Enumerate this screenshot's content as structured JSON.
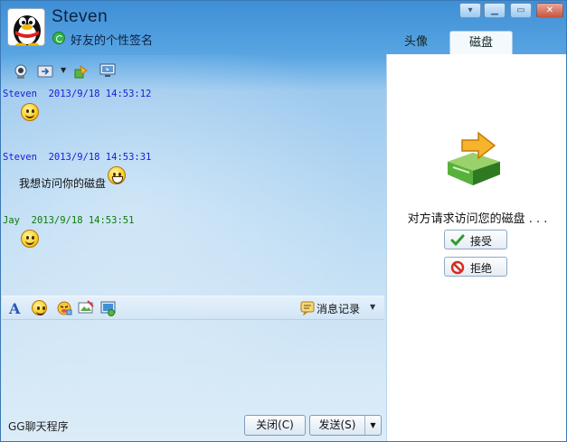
{
  "window": {
    "nickname": "Steven",
    "signature": "好友的个性签名",
    "controls": [
      "menu-icon",
      "minimize-icon",
      "maximize-icon",
      "close-icon"
    ]
  },
  "tabs": [
    {
      "label": "头像",
      "active": false
    },
    {
      "label": "磁盘",
      "active": true
    }
  ],
  "toolbar_top": {
    "icons": [
      "webcam-icon",
      "file-transfer-icon",
      "dropdown-arrow-icon",
      "apps-icon",
      "remote-desktop-icon"
    ]
  },
  "messages": [
    {
      "sender": "Steven",
      "time": "2013/9/18 14:53:12",
      "text": "",
      "emoticon": "smile-emoticon",
      "color": "#1a1ad6"
    },
    {
      "sender": "Steven",
      "time": "2013/9/18 14:53:31",
      "text": "我想访问你的磁盘",
      "emoticon": "grin-emoticon",
      "color": "#1a1ad6"
    },
    {
      "sender": "Jay",
      "time": "2013/9/18 14:53:51",
      "text": "",
      "emoticon": "smile-emoticon",
      "color": "#0b7a0b"
    }
  ],
  "input_toolbar": {
    "icons": [
      "font-icon",
      "emoticon-icon",
      "magic-emoticon-icon",
      "screenshot-icon",
      "image-icon"
    ],
    "font_glyph": "A",
    "history_label": "消息记录"
  },
  "right_panel": {
    "request_text": "对方请求访问您的磁盘 . . .",
    "accept_label": "接受",
    "reject_label": "拒绝"
  },
  "footer": {
    "app_name": "GG聊天程序",
    "close_label": "关闭(C)",
    "send_label": "发送(S)"
  }
}
